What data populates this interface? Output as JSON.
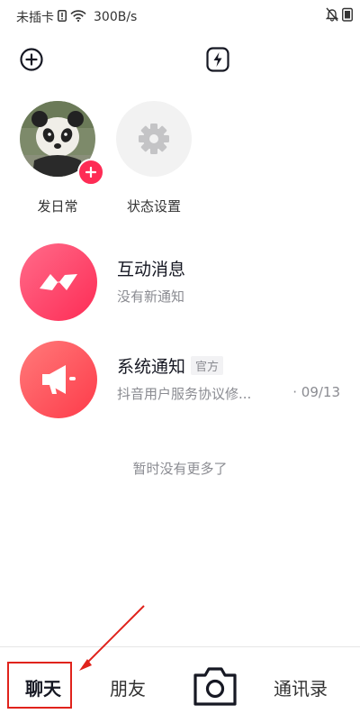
{
  "status_bar": {
    "carrier": "未插卡",
    "network_speed": "300B/s"
  },
  "quick_items": [
    {
      "label": "发日常",
      "icon": "panda-avatar"
    },
    {
      "label": "状态设置",
      "icon": "gear-icon"
    }
  ],
  "messages": [
    {
      "title": "互动消息",
      "subtitle": "没有新通知",
      "icon": "messenger-icon",
      "color": "#fe2c55"
    },
    {
      "title": "系统通知",
      "tag": "官方",
      "subtitle": "抖音用户服务协议修...",
      "date": "· 09/13",
      "icon": "megaphone-icon",
      "color": "#fe4a4a"
    }
  ],
  "empty_hint": "暂时没有更多了",
  "bottom_nav": {
    "chat": "聊天",
    "friends": "朋友",
    "contacts": "通讯录"
  },
  "colors": {
    "accent": "#fe2c55",
    "annotation": "#e0231c"
  }
}
